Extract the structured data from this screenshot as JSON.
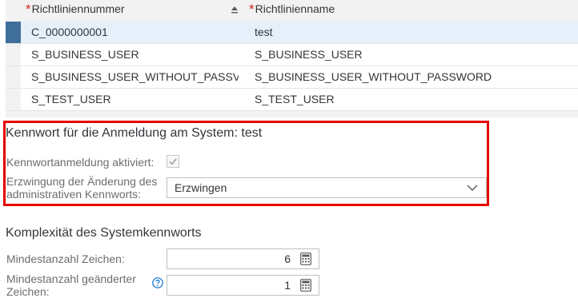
{
  "table": {
    "columns": [
      {
        "required_mark": "*",
        "label": "Richtliniennummer"
      },
      {
        "required_mark": "*",
        "label": "Richtlinienname"
      }
    ],
    "rows": [
      {
        "number": "C_0000000001",
        "name": "test",
        "selected": true
      },
      {
        "number": "S_BUSINESS_USER",
        "name": "S_BUSINESS_USER",
        "selected": false
      },
      {
        "number": "S_BUSINESS_USER_WITHOUT_PASSV",
        "name": "S_BUSINESS_USER_WITHOUT_PASSWORD",
        "selected": false
      },
      {
        "number": "S_TEST_USER",
        "name": "S_TEST_USER",
        "selected": false
      }
    ]
  },
  "kennwort": {
    "title": "Kennwort für die Anmeldung am System: test",
    "login_label": "Kennwortanmeldung aktiviert:",
    "login_checked": true,
    "enforce_label_line1": "Erzwingung der Änderung des",
    "enforce_label_line2": "administrativen Kennworts:",
    "enforce_value": "Erzwingen"
  },
  "complexity": {
    "title": "Komplexität des Systemkennworts",
    "min_chars_label": "Mindestanzahl Zeichen:",
    "min_chars_value": "6",
    "min_changed_label_line1": "Mindestanzahl geänderter",
    "min_changed_label_line2": "Zeichen:",
    "min_changed_value": "1"
  },
  "colors": {
    "accent": "#3f6e9b",
    "highlight": "#e60000",
    "required": "#d0271d",
    "help": "#0a6ed1"
  }
}
